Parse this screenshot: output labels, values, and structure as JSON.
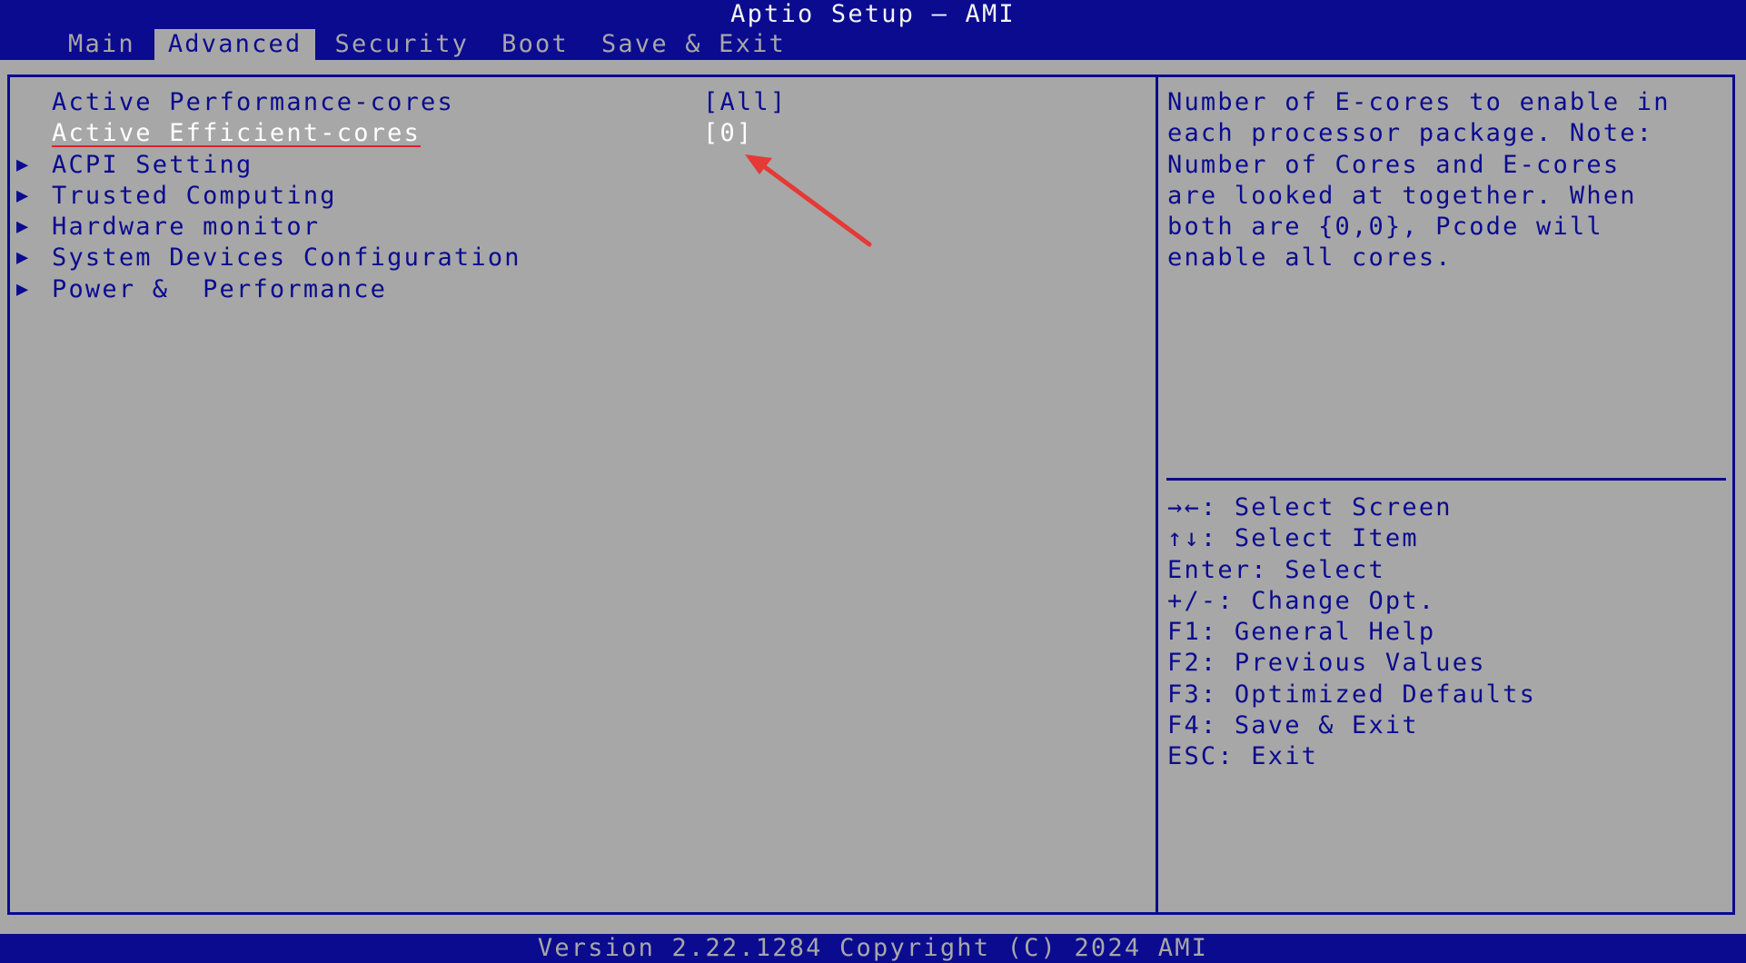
{
  "app": {
    "title": "Aptio Setup – AMI"
  },
  "tabs": [
    {
      "label": "Main",
      "active": false
    },
    {
      "label": "Advanced",
      "active": true
    },
    {
      "label": "Security",
      "active": false
    },
    {
      "label": "Boot",
      "active": false
    },
    {
      "label": "Save & Exit",
      "active": false
    }
  ],
  "settings": [
    {
      "label": "Active Performance-cores",
      "value": "[All]",
      "submenu": false,
      "selected": false
    },
    {
      "label": "Active Efficient-cores",
      "value": "[0]",
      "submenu": false,
      "selected": true
    },
    {
      "label": "ACPI Setting",
      "value": "",
      "submenu": true,
      "selected": false
    },
    {
      "label": "Trusted Computing",
      "value": "",
      "submenu": true,
      "selected": false
    },
    {
      "label": "Hardware monitor",
      "value": "",
      "submenu": true,
      "selected": false
    },
    {
      "label": "System Devices Configuration",
      "value": "",
      "submenu": true,
      "selected": false
    },
    {
      "label": "Power &  Performance",
      "value": "",
      "submenu": true,
      "selected": false
    }
  ],
  "submenu_glyph": "▶",
  "help": {
    "lines": [
      "Number of E-cores to enable in",
      "each processor package. Note:",
      "Number of Cores and E-cores",
      "are looked at together. When",
      "both are {0,0}, Pcode will",
      "enable all cores."
    ]
  },
  "keys": [
    "→←: Select Screen",
    "↑↓: Select Item",
    "Enter: Select",
    "+/-: Change Opt.",
    "F1: General Help",
    "F2: Previous Values",
    "F3: Optimized Defaults",
    "F4: Save & Exit",
    "ESC: Exit"
  ],
  "footer": {
    "version": "Version 2.22.1284 Copyright (C) 2024 AMI"
  },
  "colors": {
    "bios_blue": "#0b0b8f",
    "bios_gray": "#a7a7a7",
    "selected_text": "#ffffff",
    "annotation_red": "#e53935"
  }
}
